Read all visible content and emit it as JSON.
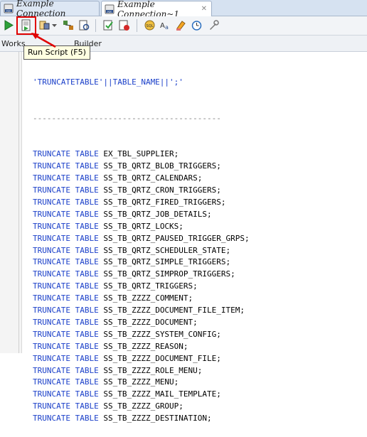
{
  "tabs": [
    {
      "label": "Example Connection"
    },
    {
      "label": "Example Connection~1"
    }
  ],
  "toolbar": {
    "tooltip": "Run Script (F5)",
    "buttons": [
      "run-statement-icon",
      "run-script-icon",
      "autotrace-icon",
      "dropdown-arrow-icon",
      "explain-plan-icon",
      "sql-tuning-icon",
      "commit-icon",
      "rollback-icon",
      "sql-icon",
      "translate-icon",
      "clear-icon",
      "history-icon",
      "tools-icon"
    ]
  },
  "worksheet_tabs": {
    "worksheet": "Works",
    "query_builder": "Builder"
  },
  "editor": {
    "header_line": "'TRUNCATETABLE'||TABLE_NAME||';'",
    "separator": "----------------------------------------",
    "keyword": "TRUNCATE TABLE",
    "tables": [
      "EX_TBL_SUPPLIER;",
      "SS_TB_QRTZ_BLOB_TRIGGERS;",
      "SS_TB_QRTZ_CALENDARS;",
      "SS_TB_QRTZ_CRON_TRIGGERS;",
      "SS_TB_QRTZ_FIRED_TRIGGERS;",
      "SS_TB_QRTZ_JOB_DETAILS;",
      "SS_TB_QRTZ_LOCKS;",
      "SS_TB_QRTZ_PAUSED_TRIGGER_GRPS;",
      "SS_TB_QRTZ_SCHEDULER_STATE;",
      "SS_TB_QRTZ_SIMPLE_TRIGGERS;",
      "SS_TB_QRTZ_SIMPROP_TRIGGERS;",
      "SS_TB_QRTZ_TRIGGERS;",
      "SS_TB_ZZZZ_COMMENT;",
      "SS_TB_ZZZZ_DOCUMENT_FILE_ITEM;",
      "SS_TB_ZZZZ_DOCUMENT;",
      "SS_TB_ZZZZ_SYSTEM_CONFIG;",
      "SS_TB_ZZZZ_REASON;",
      "SS_TB_ZZZZ_DOCUMENT_FILE;",
      "SS_TB_ZZZZ_ROLE_MENU;",
      "SS_TB_ZZZZ_MENU;",
      "SS_TB_ZZZZ_MAIL_TEMPLATE;",
      "SS_TB_ZZZZ_GROUP;",
      "SS_TB_ZZZZ_DESTINATION;"
    ]
  },
  "colors": {
    "keyword": "#1a3fc9",
    "highlight": "#e00000",
    "tooltip_bg": "#ffffe1"
  }
}
